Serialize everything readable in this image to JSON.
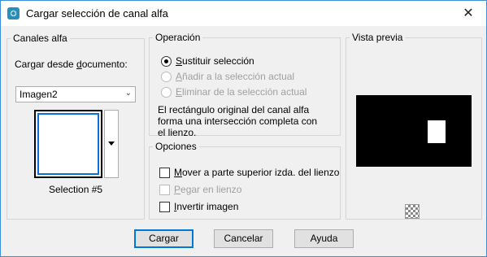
{
  "window": {
    "title": "Cargar selección de canal alfa",
    "close_glyph": "✕",
    "icon": "psp-app-icon"
  },
  "canales": {
    "legend": "Canales alfa",
    "load_label_pre": "Cargar desde ",
    "load_label_u": "d",
    "load_label_post": "ocumento:",
    "document_value": "Imagen2",
    "selection_name": "Selection #5"
  },
  "operacion": {
    "legend": "Operación",
    "options": [
      {
        "u": "S",
        "rest": "ustituir selección",
        "checked": true,
        "enabled": true
      },
      {
        "u": "A",
        "rest": "ñadir a la selección actual",
        "checked": false,
        "enabled": false
      },
      {
        "u": "E",
        "rest": "liminar de la selección actual",
        "checked": false,
        "enabled": false
      }
    ],
    "info_line1": "El rectángulo original del canal alfa",
    "info_line2": "forma una intersección completa con",
    "info_line3": "el lienzo."
  },
  "opciones": {
    "legend": "Opciones",
    "move_u": "M",
    "move_rest": "over a parte superior izda. del lienzo",
    "paste_u": "P",
    "paste_rest": "egar en lienzo",
    "invert_u": "I",
    "invert_rest": "nvertir imagen"
  },
  "vista": {
    "legend": "Vista previa"
  },
  "buttons": {
    "ok": "Cargar",
    "cancel": "Cancelar",
    "help": "Ayuda"
  },
  "colors": {
    "accent": "#0078d7",
    "window_border": "#3c8dd8"
  }
}
